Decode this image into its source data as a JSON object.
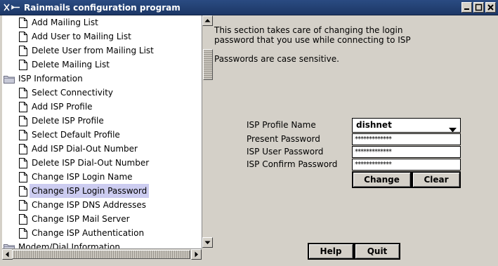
{
  "window": {
    "title": "Rainmails configuration program"
  },
  "tree": {
    "items": [
      {
        "label": "Add Mailing List",
        "type": "doc"
      },
      {
        "label": "Add User to Mailing List",
        "type": "doc"
      },
      {
        "label": "Delete User from Mailing List",
        "type": "doc"
      },
      {
        "label": "Delete Mailing List",
        "type": "doc"
      },
      {
        "label": "ISP Information",
        "type": "folder"
      },
      {
        "label": "Select Connectivity",
        "type": "doc"
      },
      {
        "label": "Add ISP Profile",
        "type": "doc"
      },
      {
        "label": "Delete ISP Profile",
        "type": "doc"
      },
      {
        "label": "Select Default Profile",
        "type": "doc"
      },
      {
        "label": "Add ISP Dial-Out Number",
        "type": "doc"
      },
      {
        "label": "Delete ISP Dial-Out Number",
        "type": "doc"
      },
      {
        "label": "Change ISP Login Name",
        "type": "doc"
      },
      {
        "label": "Change ISP Login Password",
        "type": "doc",
        "selected": true
      },
      {
        "label": "Change ISP DNS Addresses",
        "type": "doc"
      },
      {
        "label": "Change ISP Mail Server",
        "type": "doc"
      },
      {
        "label": "Change ISP Authentication",
        "type": "doc"
      },
      {
        "label": "Modem/Dial Information",
        "type": "folder"
      }
    ]
  },
  "content": {
    "description_line1": "This section takes care of changing the login",
    "description_line2": "password that you use while connecting to ISP",
    "note": "Passwords are case sensitive.",
    "form": {
      "profile_label": "ISP Profile Name",
      "profile_value": "dishnet",
      "present_label": "Present Password",
      "present_value": "*************",
      "user_label": "ISP User Password",
      "user_value": "*************",
      "confirm_label": "ISP Confirm Password",
      "confirm_value": "*************"
    },
    "change_label": "Change",
    "clear_label": "Clear",
    "help_label": "Help",
    "quit_label": "Quit"
  },
  "colors": {
    "titlebar": "#1c3766",
    "background": "#d4d0c8",
    "selection": "#ccccf0"
  }
}
